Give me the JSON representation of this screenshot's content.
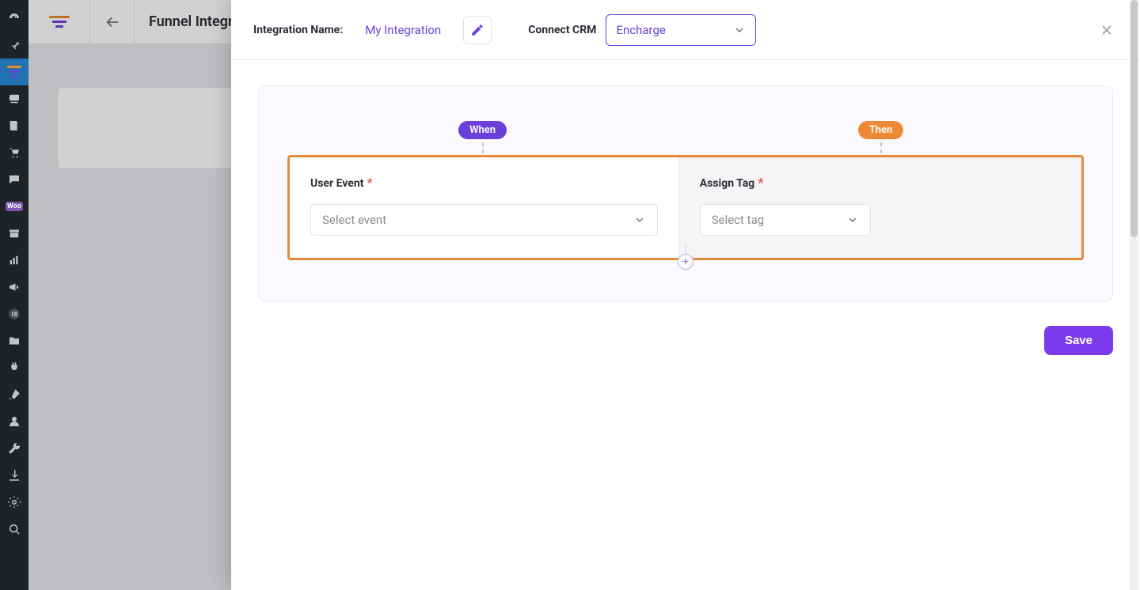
{
  "page": {
    "title": "Funnel Integrations"
  },
  "sidebar": {
    "items": [
      "dashboard",
      "pin",
      "funnels",
      "media",
      "pages",
      "cart",
      "comments",
      "woo",
      "appearance",
      "analytics",
      "marketing",
      "elementor",
      "templates",
      "plugins",
      "tools",
      "users",
      "settings",
      "snippets",
      "cache",
      "seo"
    ]
  },
  "modal": {
    "integration_name_label": "Integration Name:",
    "integration_name_value": "My Integration",
    "connect_crm_label": "Connect CRM",
    "crm_selected": "Encharge",
    "pills": {
      "when": "When",
      "then": "Then"
    },
    "when_panel": {
      "label": "User Event",
      "required": "*",
      "placeholder": "Select event"
    },
    "then_panel": {
      "label": "Assign Tag",
      "required": "*",
      "placeholder": "Select tag"
    },
    "save_label": "Save",
    "add_label": "+"
  },
  "colors": {
    "accent": "#6b40d9",
    "highlight": "#e38b3a",
    "save": "#7c3aed"
  }
}
